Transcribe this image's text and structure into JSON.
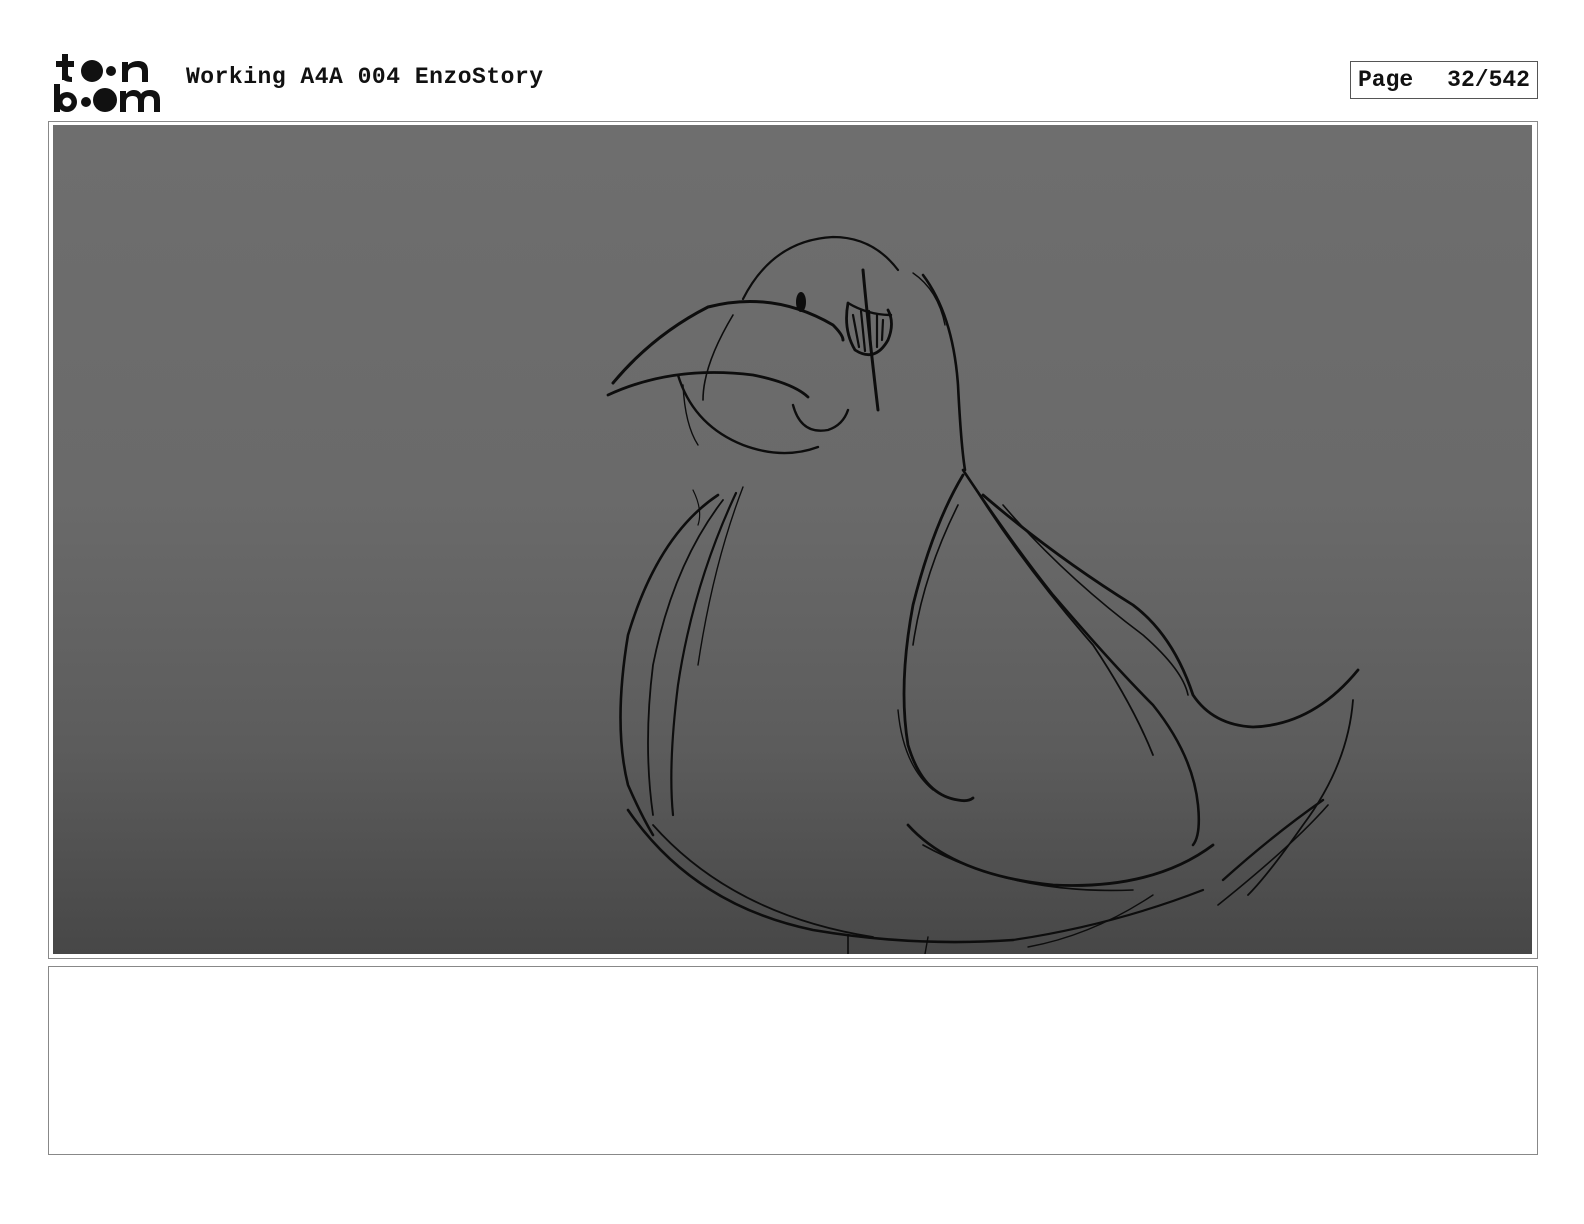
{
  "header": {
    "logo_text": "toon boom",
    "project_title": "Working A4A 004 EnzoStory",
    "page_label": "Page",
    "page_number": "32/542"
  },
  "panel": {
    "image_subject": "bird-sketch"
  },
  "notes": {
    "text": ""
  }
}
